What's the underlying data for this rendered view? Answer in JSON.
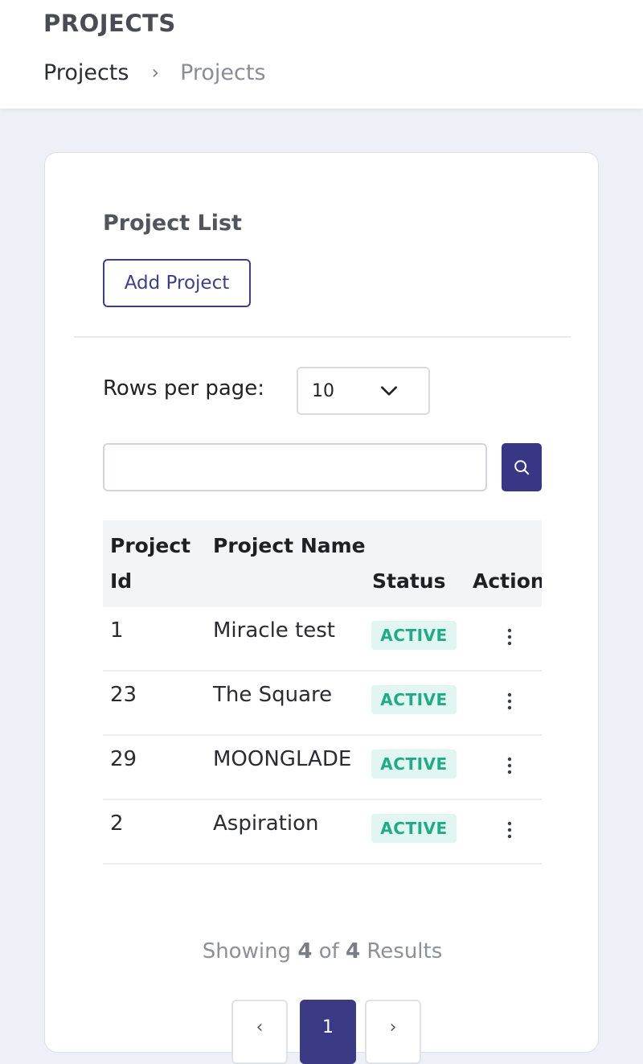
{
  "header": {
    "title": "PROJECTS",
    "breadcrumb": [
      "Projects",
      "Projects"
    ]
  },
  "card": {
    "title": "Project List",
    "add_button": "Add Project",
    "rows_per_page_label": "Rows per page:",
    "rows_per_page_value": "10",
    "search_placeholder": ""
  },
  "table": {
    "headers": {
      "id": "Project Id",
      "name": "Project Name",
      "status": "Status",
      "action": "Action"
    },
    "rows": [
      {
        "id": "1",
        "name": "Miracle test",
        "status": "ACTIVE"
      },
      {
        "id": "23",
        "name": "The Square",
        "status": "ACTIVE"
      },
      {
        "id": "29",
        "name": "MOONGLADE",
        "status": "ACTIVE"
      },
      {
        "id": "2",
        "name": "Aspiration",
        "status": "ACTIVE"
      }
    ]
  },
  "footer": {
    "showing_prefix": "Showing",
    "shown": "4",
    "of": "of",
    "total": "4",
    "suffix": "Results",
    "current_page": "1"
  },
  "colors": {
    "primary": "#383786",
    "active_badge_bg": "#e2f6f1",
    "active_badge_text": "#22a987",
    "page_bg": "#eef0f7"
  }
}
